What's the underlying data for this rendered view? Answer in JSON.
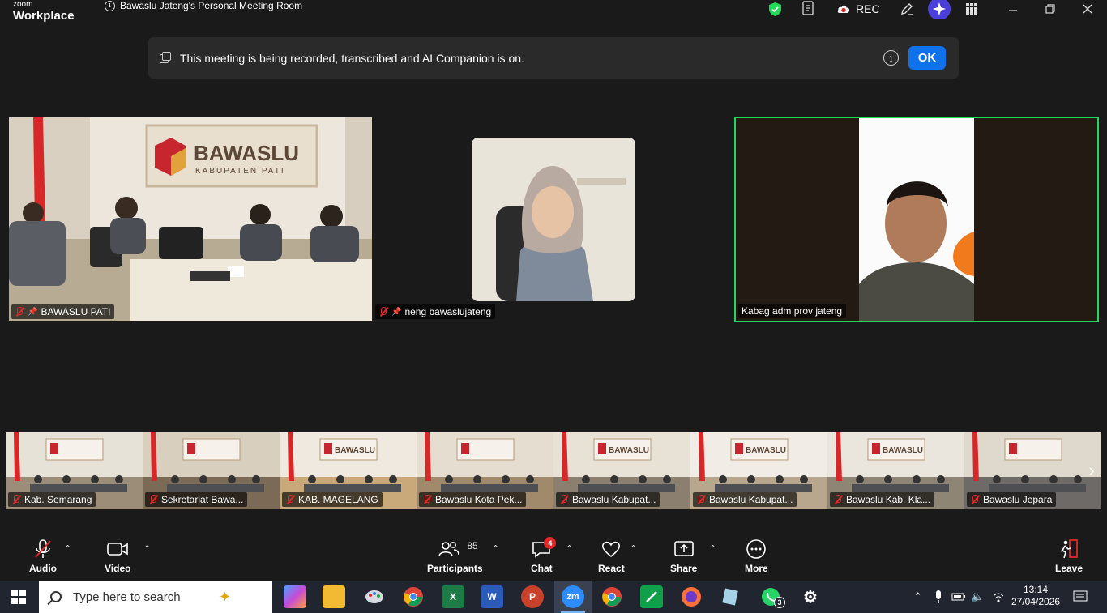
{
  "app": {
    "brand_small": "zoom",
    "brand_large": "Workplace",
    "meeting_title": "Bawaslu Jateng's Personal Meeting Room",
    "rec_label": "REC"
  },
  "banner": {
    "text": "This meeting is being recorded, transcribed and AI Companion is on.",
    "ok_label": "OK"
  },
  "tiles": [
    {
      "name": "BAWASLU PATI",
      "sign_main": "BAWASLU",
      "sign_sub": "KABUPATEN PATI"
    },
    {
      "name": "neng bawaslujateng"
    },
    {
      "name": "Kabag adm prov jateng"
    }
  ],
  "filmstrip": [
    {
      "name": "Kab. Semarang",
      "sign": ""
    },
    {
      "name": "Sekretariat Bawa...",
      "sign": ""
    },
    {
      "name": "KAB. MAGELANG",
      "sign": "BAWASLU"
    },
    {
      "name": "Bawaslu Kota Pek...",
      "sign": ""
    },
    {
      "name": "Bawaslu Kabupat...",
      "sign": "BAWASLU"
    },
    {
      "name": "Bawaslu Kabupat...",
      "sign": "BAWASLU"
    },
    {
      "name": "Bawaslu Kab. Kla...",
      "sign": "BAWASLU"
    },
    {
      "name": "Bawaslu Jepara",
      "sign": ""
    }
  ],
  "toolbar": {
    "audio": "Audio",
    "video": "Video",
    "participants": "Participants",
    "participants_count": "85",
    "chat": "Chat",
    "chat_badge": "4",
    "react": "React",
    "share": "Share",
    "more": "More",
    "leave": "Leave"
  },
  "taskbar": {
    "search_placeholder": "Type here to search",
    "time": "13:14",
    "date": "27/04/2026",
    "whatsapp_badge": "3"
  },
  "colors": {
    "accent": "#0e72ed",
    "active_speaker": "#23d959",
    "mute": "#e02828",
    "bg": "#1a1a1a"
  }
}
